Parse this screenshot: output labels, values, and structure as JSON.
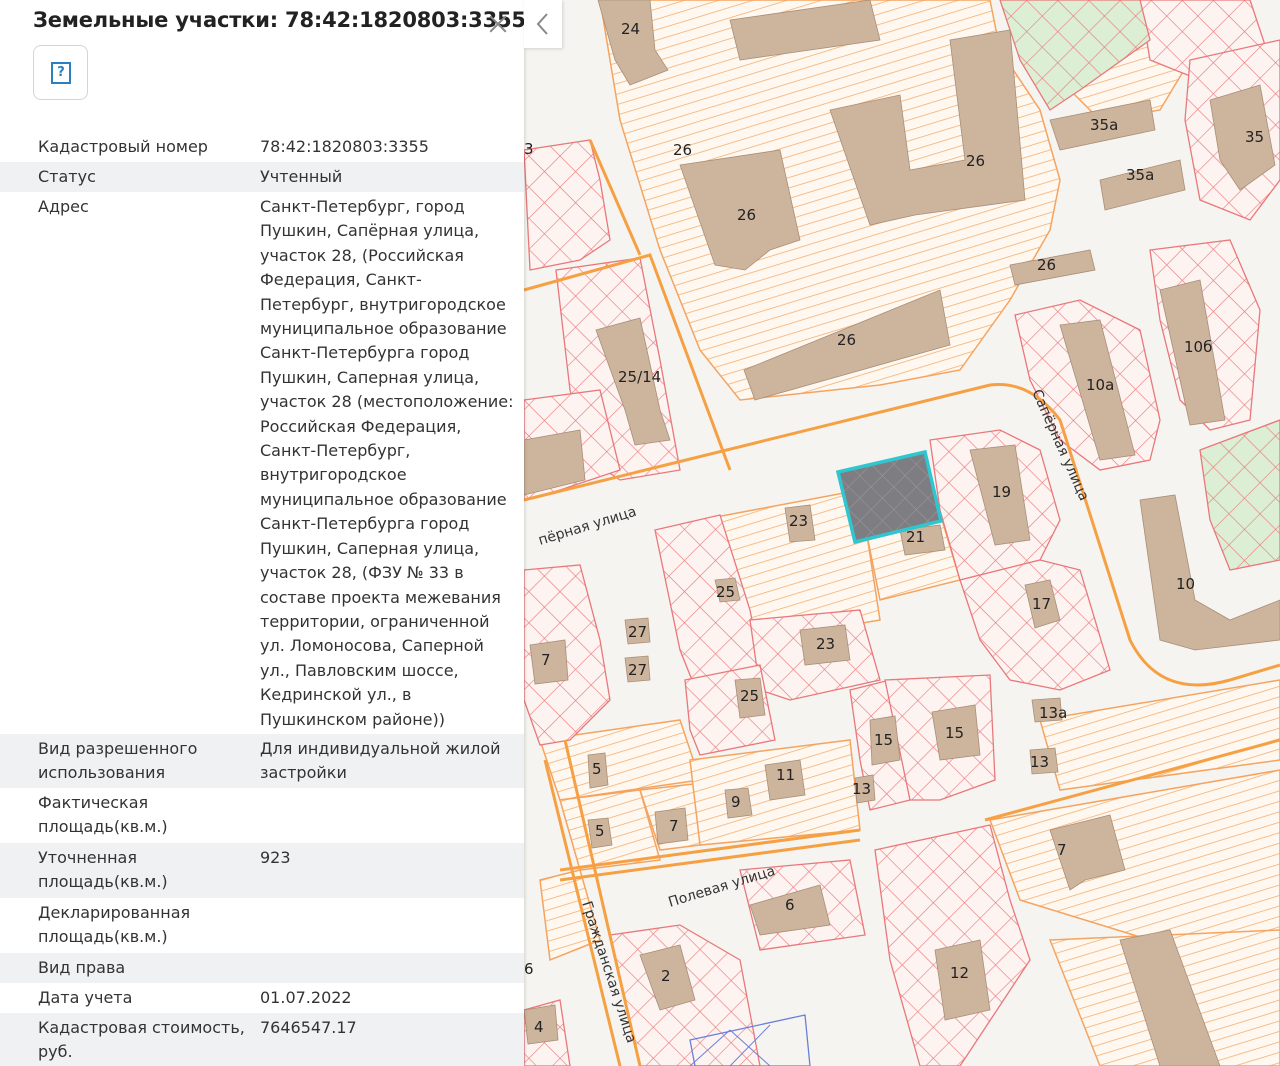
{
  "panel": {
    "title": "Земельные участки: 78:42:1820803:3355",
    "help_glyph": "?",
    "rows": [
      {
        "key": "Кадастровый номер",
        "value": "78:42:1820803:3355"
      },
      {
        "key": "Статус",
        "value": "Учтенный"
      },
      {
        "key": "Адрес",
        "value": "Санкт-Петербург, город Пушкин, Сапёрная улица, участок 28, (Российская Федерация, Санкт-Петербург, внутригородское муниципальное образование Санкт-Петербурга город Пушкин, Саперная улица, участок 28 (местоположение: Российская Федерация, Санкт-Петербург, внутригородское муниципальное образование Санкт-Петербурга город Пушкин, Саперная улица, участок 28, (ФЗУ № 33 в составе проекта межевания территории, ограниченной ул. Ломоносова, Саперной ул., Павловским шоссе, Кедринской ул., в Пушкинском районе))"
      },
      {
        "key": "Вид разрешенного использования",
        "value": "Для индивидуальной жилой застройки"
      },
      {
        "key": "Фактическая площадь(кв.м.)",
        "value": ""
      },
      {
        "key": "Уточненная площадь(кв.м.)",
        "value": "923"
      },
      {
        "key": "Декларированная площадь(кв.м.)",
        "value": ""
      },
      {
        "key": "Вид права",
        "value": ""
      },
      {
        "key": "Дата учета",
        "value": "01.07.2022"
      },
      {
        "key": "Кадастровая стоимость, руб.",
        "value": "7646547.17"
      }
    ]
  },
  "map": {
    "streets": {
      "sapernaya_left": "пёрная улица",
      "sapernaya_right": "Сапёрная улица",
      "polevaya": "Полевая улица",
      "grazhdanskaya": "Гражданская улица"
    },
    "house_numbers": [
      "24",
      "26",
      "26",
      "26",
      "26",
      "26",
      "35а",
      "35а",
      "35",
      "3",
      "25/14",
      "10а",
      "10б",
      "19",
      "21",
      "23",
      "25",
      "27",
      "27",
      "7",
      "23",
      "25",
      "17",
      "13а",
      "15",
      "15",
      "13",
      "13",
      "11",
      "9",
      "7",
      "5",
      "5",
      "7",
      "6",
      "2",
      "12",
      "4",
      "6",
      "10"
    ],
    "colors": {
      "building": "#cdb49d",
      "parcel_line": "#f4a460",
      "hatch_red": "#e8787a",
      "road": "#f6a044",
      "selected_fill": "#7d7d82",
      "selected_outline": "#2fc6d0",
      "park": "#d9ecd0"
    }
  }
}
